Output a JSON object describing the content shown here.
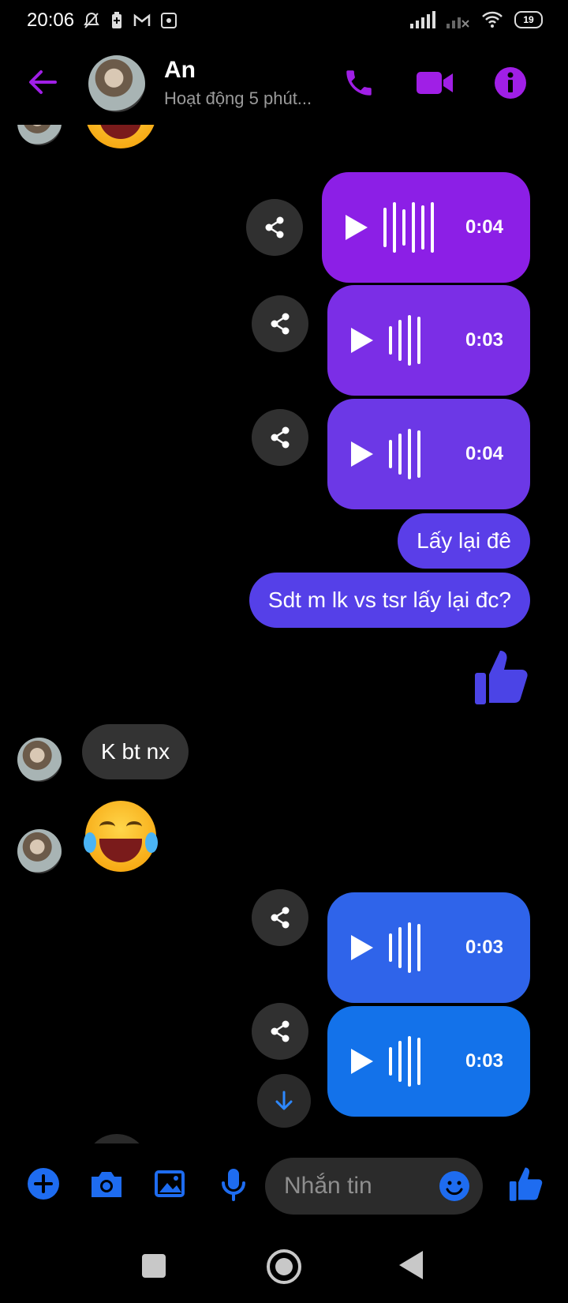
{
  "status_bar": {
    "time": "20:06",
    "battery": "19"
  },
  "header": {
    "contact_name": "An",
    "status": "Hoạt động 5 phút..."
  },
  "messages": [
    {
      "type": "voice",
      "duration": "0:04",
      "color": "#8c1fe6"
    },
    {
      "type": "voice",
      "duration": "0:03",
      "color": "#7b2ee6"
    },
    {
      "type": "voice",
      "duration": "0:04",
      "color": "#6c38e6"
    },
    {
      "type": "text",
      "text": "Lấy lại đê",
      "color": "#5a3ee8"
    },
    {
      "type": "text",
      "text": "Sdt m lk vs tsr lấy lại đc?",
      "color": "#5540e8"
    },
    {
      "type": "like",
      "color": "#4b44e6"
    },
    {
      "type": "incoming_text",
      "text": "K bt nx",
      "color": "#333333"
    },
    {
      "type": "incoming_emoji",
      "emoji": "face-with-tears-of-joy"
    },
    {
      "type": "voice",
      "duration": "0:03",
      "color": "#2f64ea"
    },
    {
      "type": "voice",
      "duration": "0:03",
      "color": "#1372ea"
    }
  ],
  "composer": {
    "placeholder": "Nhắn tin"
  },
  "colors": {
    "accent": "#a01fe6",
    "composer_blue": "#1e6cf0"
  }
}
